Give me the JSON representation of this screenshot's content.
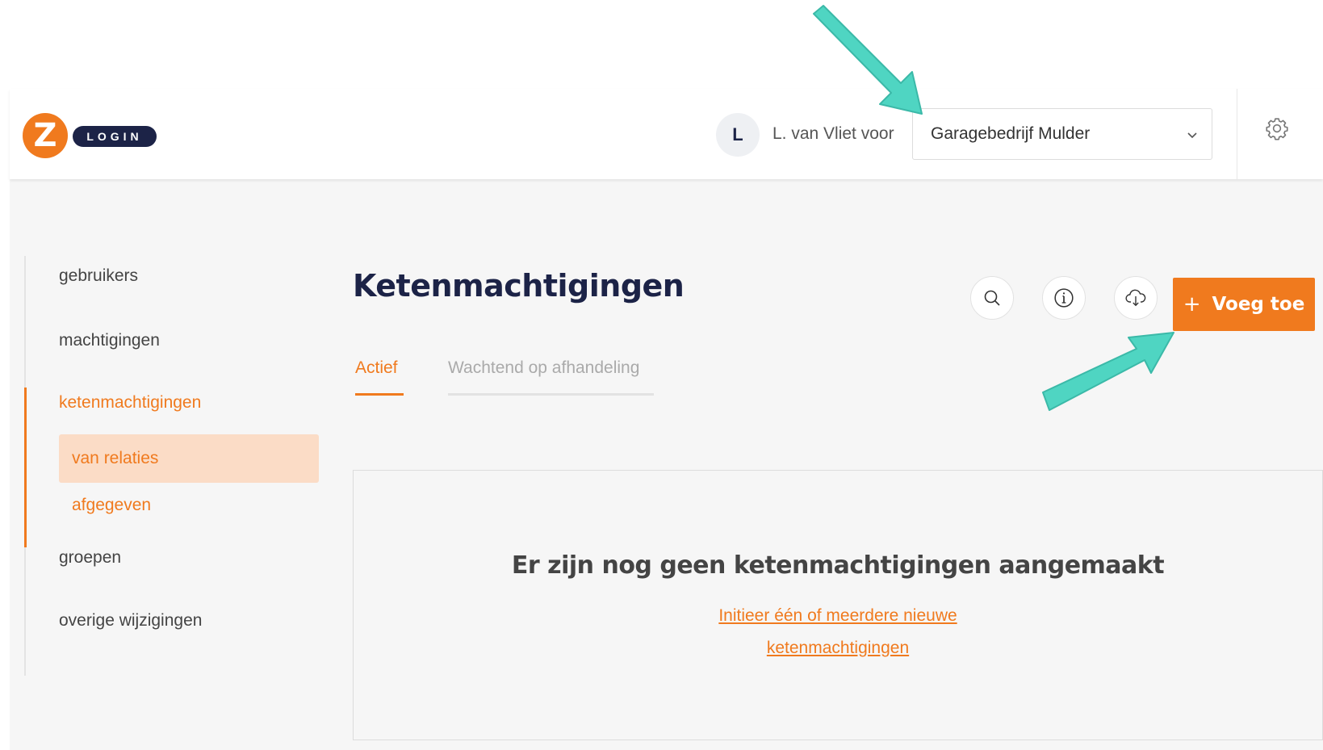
{
  "header": {
    "logo_letter": "Z",
    "logo_text": "LOGIN",
    "avatar_initial": "L",
    "user_label": "L. van Vliet voor",
    "organization_select": {
      "selected": "Garagebedrijf Mulder"
    }
  },
  "sidebar": {
    "items": [
      {
        "label": "gebruikers",
        "active": false
      },
      {
        "label": "machtigingen",
        "active": false
      },
      {
        "label": "ketenmachtigingen",
        "active": true
      },
      {
        "label": "groepen",
        "active": false
      },
      {
        "label": "overige wijzigingen",
        "active": false
      }
    ],
    "subitems": [
      {
        "label": "van relaties",
        "active": true
      },
      {
        "label": "afgegeven",
        "active": false
      }
    ]
  },
  "main": {
    "title": "Ketenmachtigingen",
    "add_button_label": "Voeg toe",
    "add_button_plus": "+",
    "tabs": [
      {
        "label": "Actief",
        "active": true
      },
      {
        "label": "Wachtend op afhandeling",
        "active": false
      }
    ],
    "empty_state": {
      "title": "Er zijn nog geen ketenmachtigingen aangemaakt",
      "link_line1": "Initieer één of meerdere nieuwe",
      "link_line2": "ketenmachtigingen"
    }
  },
  "colors": {
    "accent": "#f07a1e",
    "navy": "#1c2347",
    "annotation_arrow": "#4fd5c2",
    "active_subitem_bg": "#fbdcc6"
  }
}
